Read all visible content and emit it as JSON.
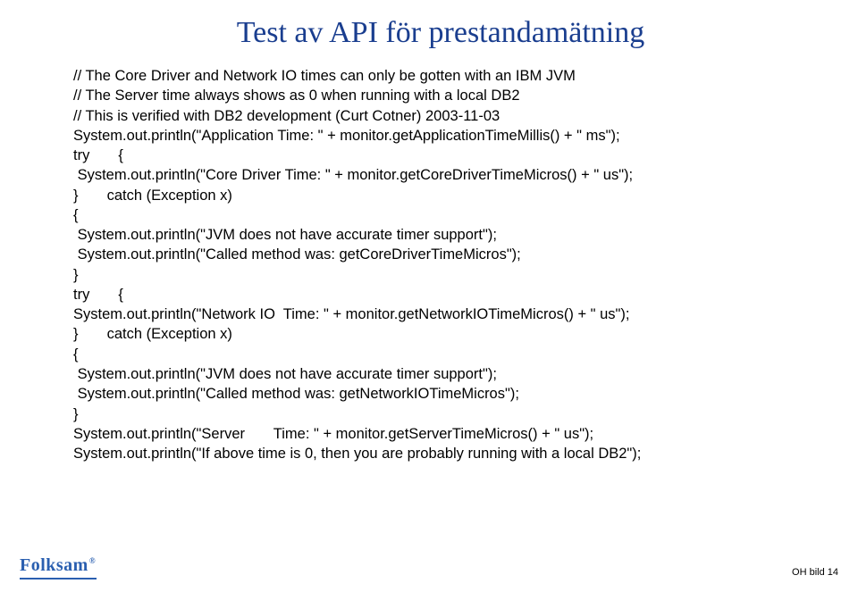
{
  "title": "Test av API för prestandamätning",
  "code": "// The Core Driver and Network IO times can only be gotten with an IBM JVM\n// The Server time always shows as 0 when running with a local DB2\n// This is verified with DB2 development (Curt Cotner) 2003-11-03\nSystem.out.println(\"Application Time: \" + monitor.getApplicationTimeMillis() + \" ms\");\ntry       {\n System.out.println(\"Core Driver Time: \" + monitor.getCoreDriverTimeMicros() + \" us\");\n}       catch (Exception x)\n{\n System.out.println(\"JVM does not have accurate timer support\");\n System.out.println(\"Called method was: getCoreDriverTimeMicros\");\n}\ntry       {\nSystem.out.println(\"Network IO  Time: \" + monitor.getNetworkIOTimeMicros() + \" us\");\n}       catch (Exception x)\n{\n System.out.println(\"JVM does not have accurate timer support\");\n System.out.println(\"Called method was: getNetworkIOTimeMicros\");\n}\nSystem.out.println(\"Server       Time: \" + monitor.getServerTimeMicros() + \" us\");\nSystem.out.println(\"If above time is 0, then you are probably running with a local DB2\");",
  "logo": {
    "text": "Folksam",
    "reg": "®"
  },
  "page_number": "OH bild 14"
}
